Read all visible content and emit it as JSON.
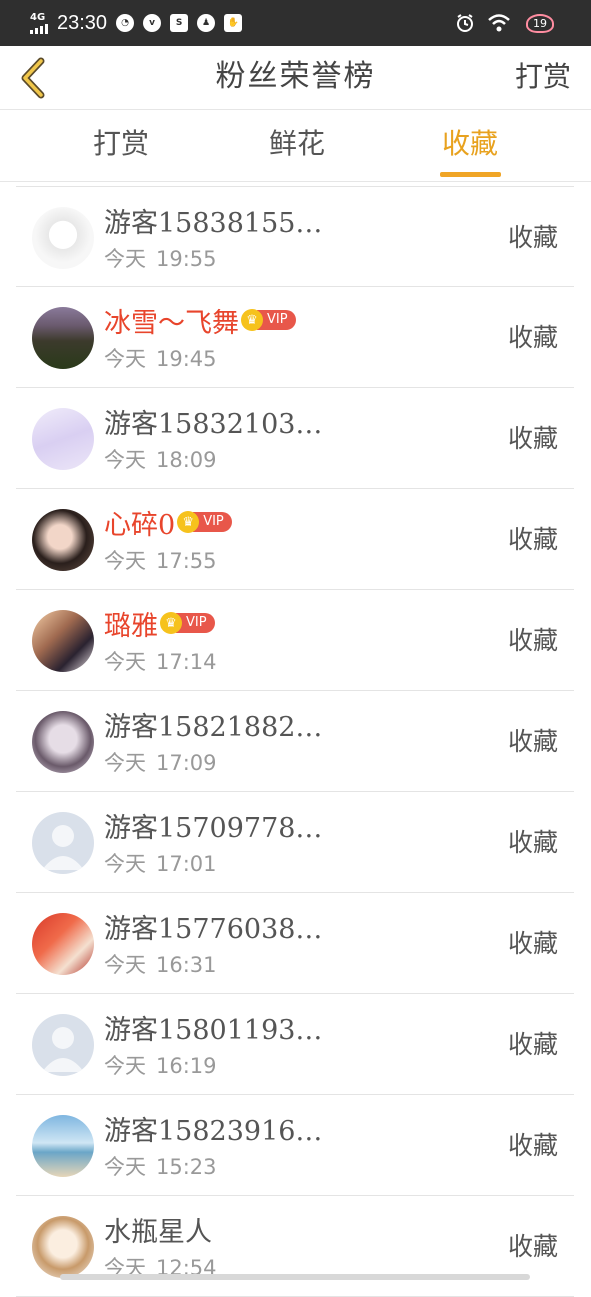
{
  "status_bar": {
    "network": "4G",
    "time": "23:30",
    "battery": "19",
    "left_icons": [
      "speedometer-icon",
      "vivo-icon",
      "s-icon",
      "qq-icon",
      "hand-icon"
    ],
    "right_icons": [
      "alarm-icon",
      "wifi-icon"
    ]
  },
  "header": {
    "title": "粉丝荣誉榜",
    "action": "打赏",
    "back_icon": "chevron-left-icon"
  },
  "tabs": [
    {
      "label": "打赏",
      "active": false
    },
    {
      "label": "鲜花",
      "active": false
    },
    {
      "label": "收藏",
      "active": true
    }
  ],
  "colors": {
    "accent": "#f0a526",
    "vip_name": "#e8452c",
    "status_bar_bg": "#2f2f2f"
  },
  "today_label": "今天",
  "items": [
    {
      "name": "游客15838155…",
      "vip": false,
      "vip_label": "",
      "time": "19:55",
      "action": "收藏",
      "avatar": "chibi-character-avatar"
    },
    {
      "name": "冰雪～飞舞",
      "vip": true,
      "vip_label": "VIP",
      "time": "19:45",
      "action": "收藏",
      "avatar": "landscape-photo-avatar"
    },
    {
      "name": "游客15832103…",
      "vip": false,
      "vip_label": "",
      "time": "18:09",
      "action": "收藏",
      "avatar": "purple-sketch-avatar"
    },
    {
      "name": "心碎0",
      "vip": true,
      "vip_label": "VIP",
      "time": "17:55",
      "action": "收藏",
      "avatar": "girl-photo-avatar"
    },
    {
      "name": "璐雅",
      "vip": true,
      "vip_label": "VIP",
      "time": "17:14",
      "action": "收藏",
      "avatar": "anime-girl-avatar"
    },
    {
      "name": "游客15821882…",
      "vip": false,
      "vip_label": "",
      "time": "17:09",
      "action": "收藏",
      "avatar": "blurred-girl-avatar"
    },
    {
      "name": "游客15709778…",
      "vip": false,
      "vip_label": "",
      "time": "17:01",
      "action": "收藏",
      "avatar": "default-user-avatar"
    },
    {
      "name": "游客15776038…",
      "vip": false,
      "vip_label": "",
      "time": "16:31",
      "action": "收藏",
      "avatar": "red-flowers-avatar"
    },
    {
      "name": "游客15801193…",
      "vip": false,
      "vip_label": "",
      "time": "16:19",
      "action": "收藏",
      "avatar": "default-user-avatar"
    },
    {
      "name": "游客15823916…",
      "vip": false,
      "vip_label": "",
      "time": "15:23",
      "action": "收藏",
      "avatar": "beach-silhouette-avatar"
    },
    {
      "name": "水瓶星人",
      "vip": false,
      "vip_label": "",
      "time": "12:54",
      "action": "收藏",
      "avatar": "cartoon-girl-avatar"
    }
  ]
}
